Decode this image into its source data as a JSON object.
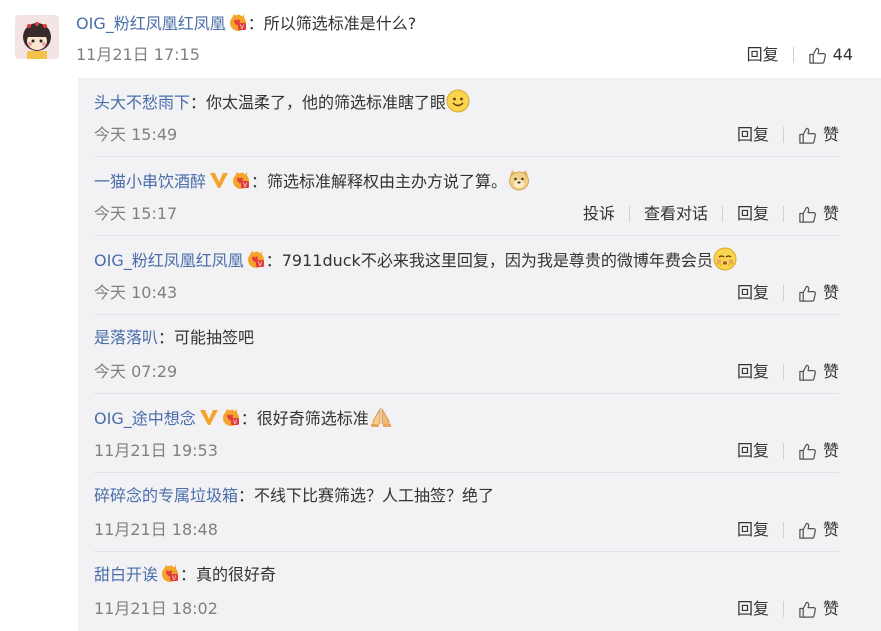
{
  "top_comment": {
    "username": "OIG_粉红凤凰红凤凰",
    "separator": "：",
    "text": "所以筛选标准是什么?",
    "time": "11月21日 17:15",
    "reply_label": "回复",
    "like_count": "44"
  },
  "replies": [
    {
      "username": "头大不愁雨下",
      "separator": "：",
      "text": "你太温柔了，他的筛选标准瞎了眼",
      "time": "今天 15:49",
      "reply_label": "回复",
      "like_label": "赞"
    },
    {
      "username": "一猫小串饮酒醉",
      "separator": "：",
      "text": "筛选标准解释权由主办方说了算。",
      "time": "今天 15:17",
      "report_label": "投诉",
      "view_label": "查看对话",
      "reply_label": "回复",
      "like_label": "赞"
    },
    {
      "username": "OIG_粉红凤凰红凤凰",
      "separator": "：",
      "text": "7911duck不必来我这里回复，因为我是尊贵的微博年费会员",
      "time": "今天 10:43",
      "reply_label": "回复",
      "like_label": "赞"
    },
    {
      "username": "是落落叭",
      "separator": "：",
      "text": "可能抽签吧",
      "time": "今天 07:29",
      "reply_label": "回复",
      "like_label": "赞"
    },
    {
      "username": "OIG_途中想念",
      "separator": "：",
      "text": "很好奇筛选标准",
      "time": "11月21日 19:53",
      "reply_label": "回复",
      "like_label": "赞"
    },
    {
      "username": "碎碎念的专属垃圾箱",
      "separator": "：",
      "text": "不线下比赛筛选？人工抽签？绝了",
      "time": "11月21日 18:48",
      "reply_label": "回复",
      "like_label": "赞"
    },
    {
      "username": "甜白开诶",
      "separator": "：",
      "text": "真的很好奇",
      "time": "11月21日 18:02",
      "reply_label": "回复",
      "like_label": "赞"
    }
  ],
  "colors": {
    "username": "#4a6ea9",
    "verified_orange": "#f4a42c",
    "vip_red": "#e33c3c",
    "panel_bg": "#f2f2f5"
  },
  "icons": [
    "avatar",
    "vip-member-icon",
    "verified-v-icon",
    "smile-emoji-icon",
    "doge-emoji-icon",
    "shy-emoji-icon",
    "pray-emoji-icon",
    "thumbs-up-icon"
  ]
}
